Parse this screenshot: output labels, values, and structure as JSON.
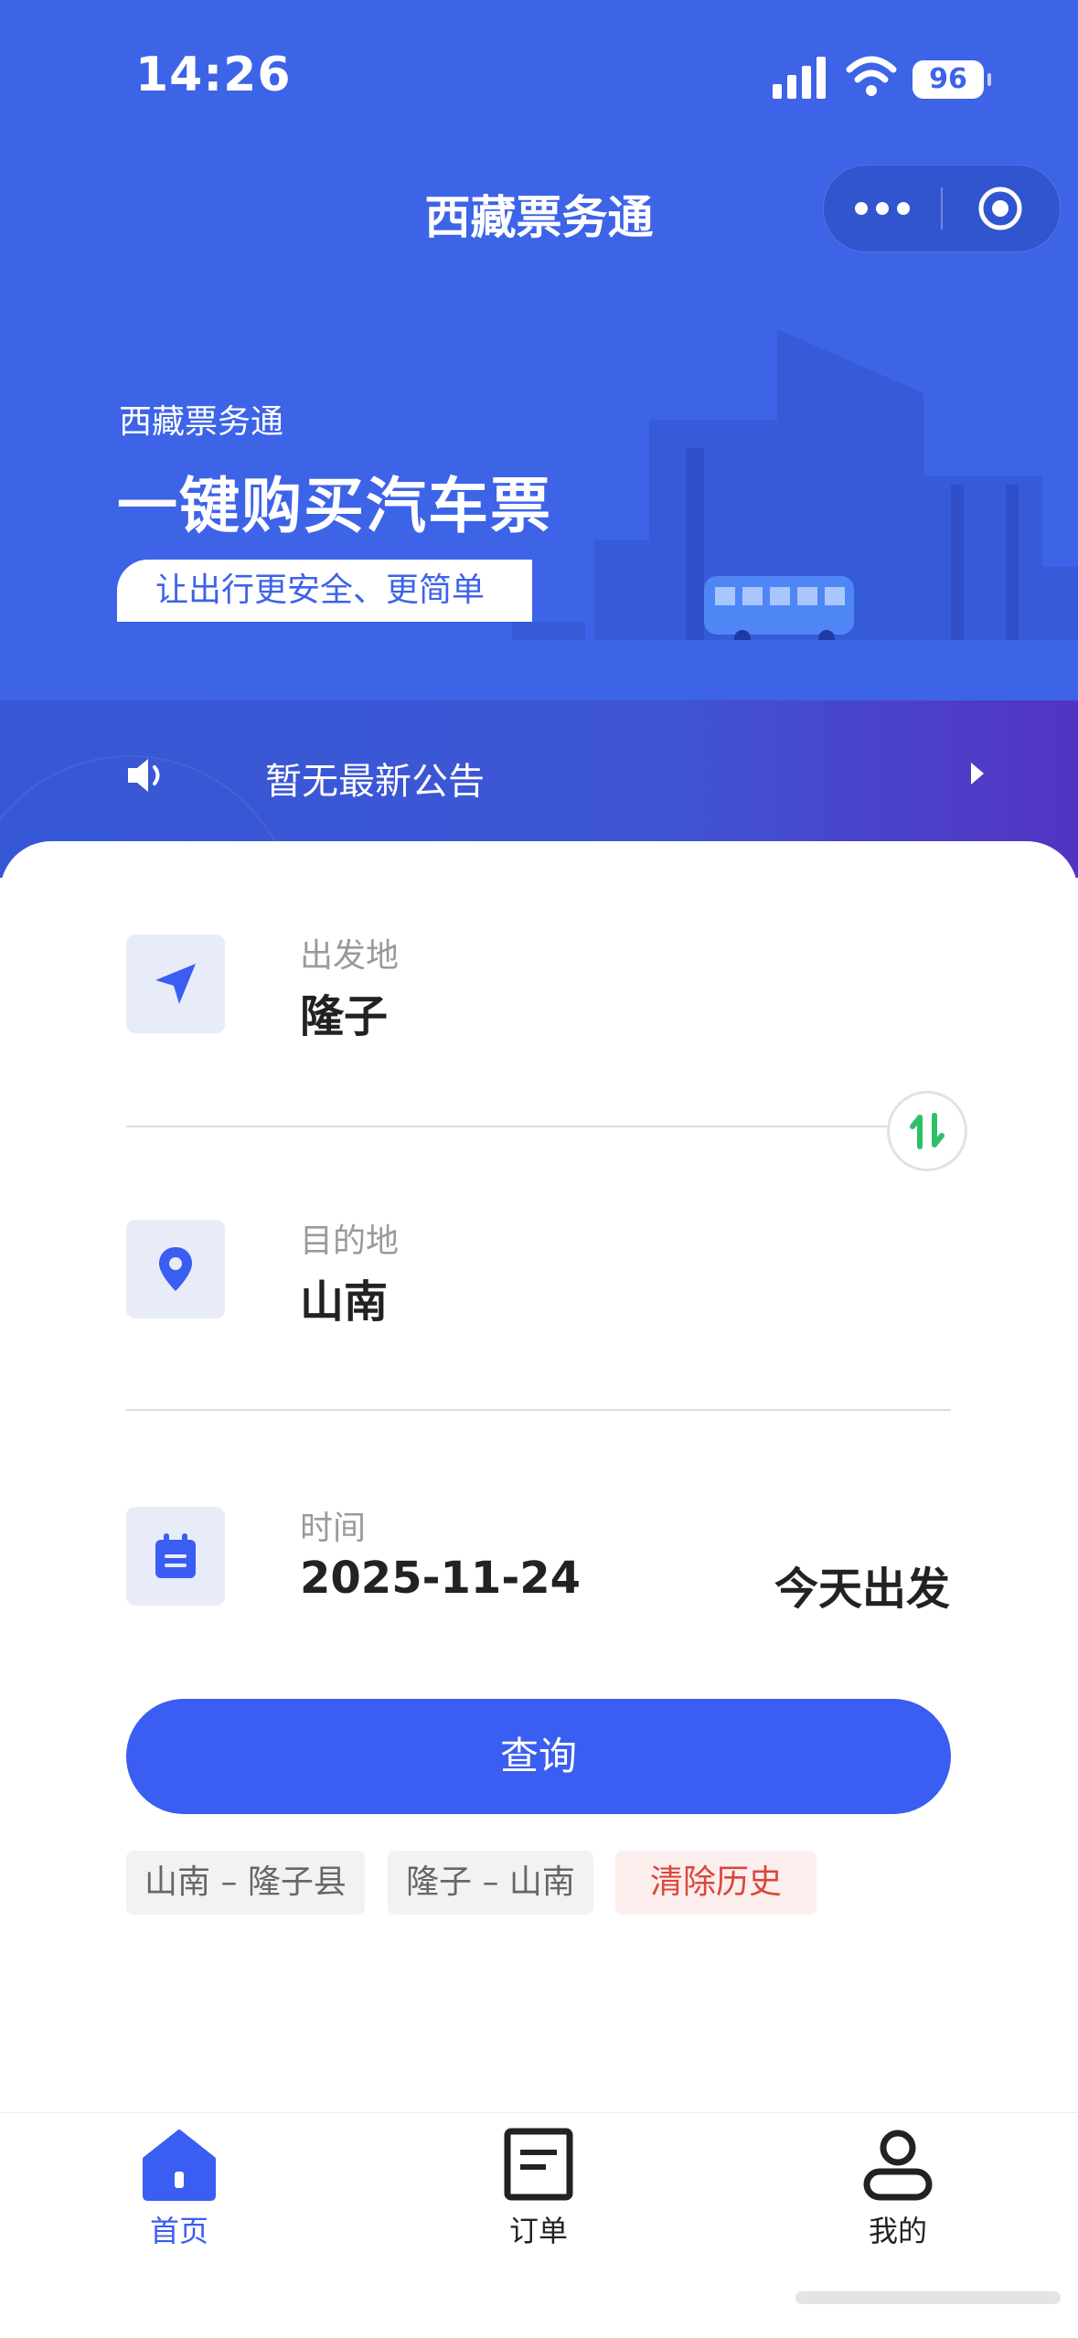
{
  "status_bar": {
    "time": "14:26",
    "battery": "96"
  },
  "nav": {
    "title": "西藏票务通",
    "more_icon": "more-dots-icon",
    "close_icon": "target-icon"
  },
  "banner": {
    "subtitle": "西藏票务通",
    "title": "一键购买汽车票",
    "slogan": "让出行更安全、更简单"
  },
  "notice": {
    "text": "暂无最新公告",
    "icon": "speaker-icon"
  },
  "form": {
    "departure_label": "出发地",
    "departure_value": "隆子",
    "destination_label": "目的地",
    "destination_value": "山南",
    "date_label": "时间",
    "date_value": "2025-11-24",
    "date_hint": "今天出发",
    "query_label": "查询"
  },
  "history": {
    "items": [
      "山南 – 隆子县",
      "隆子 – 山南"
    ],
    "clear_label": "清除历史"
  },
  "tabbar": {
    "items": [
      {
        "label": "首页",
        "icon": "home-icon",
        "active": true
      },
      {
        "label": "订单",
        "icon": "order-icon",
        "active": false
      },
      {
        "label": "我的",
        "icon": "user-icon",
        "active": false
      }
    ]
  },
  "colors": {
    "primary": "#3a5df2",
    "hero_bg": "#3d63e7",
    "swap_green": "#2fbf6b",
    "clear_red": "#d9483b"
  }
}
